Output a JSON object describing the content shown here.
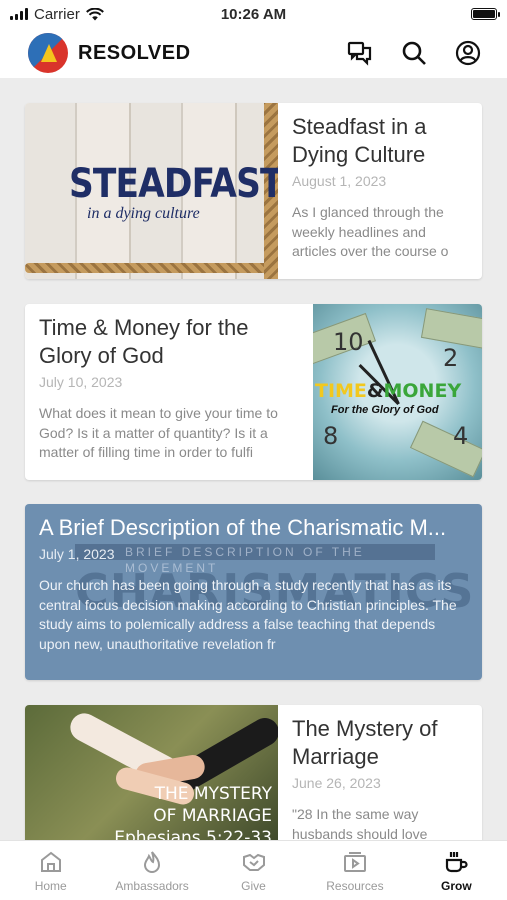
{
  "status": {
    "carrier": "Carrier",
    "time": "10:26 AM"
  },
  "app": {
    "name": "RESOLVED"
  },
  "posts": [
    {
      "title": "Steadfast in a Dying Culture",
      "date": "August 1, 2023",
      "excerpt": "As I glanced through the weekly headlines and articles over the course o",
      "image_text": {
        "word": "STEADFAST",
        "sub": "in a dying culture"
      }
    },
    {
      "title": "Time & Money for the Glory of God",
      "date": "July 10, 2023",
      "excerpt": "What does it mean to give your time to God? Is it a matter of quantity? Is it a matter of filling time in order to fulfi",
      "image_text": {
        "time": "TIME",
        "amp": "&",
        "money": "MONEY",
        "tag": "For the Glory of God"
      }
    },
    {
      "title": "A Brief Description of the Charismatic M...",
      "date": "July 1, 2023",
      "excerpt": "Our church has been going through a study recently that has as its central focus decision making according to Christian principles. The study aims to polemically address a false teaching that depends upon new, unauthoritative revelation fr",
      "image_text": {
        "band": "BRIEF DESCRIPTION OF THE MOVEMENT",
        "word": "CHARISMATICS"
      }
    },
    {
      "title": "The Mystery of Marriage",
      "date": "June 26, 2023",
      "excerpt": "\"28 In the same way husbands should love",
      "image_text": {
        "line1": "THE MYSTERY",
        "line2": "OF MARRIAGE",
        "line3": "Ephesians 5:22-33"
      }
    }
  ],
  "tabs": [
    {
      "label": "Home",
      "icon": "home-icon"
    },
    {
      "label": "Ambassadors",
      "icon": "flame-icon"
    },
    {
      "label": "Give",
      "icon": "handshake-icon"
    },
    {
      "label": "Resources",
      "icon": "video-icon"
    },
    {
      "label": "Grow",
      "icon": "coffee-icon",
      "active": true
    }
  ]
}
